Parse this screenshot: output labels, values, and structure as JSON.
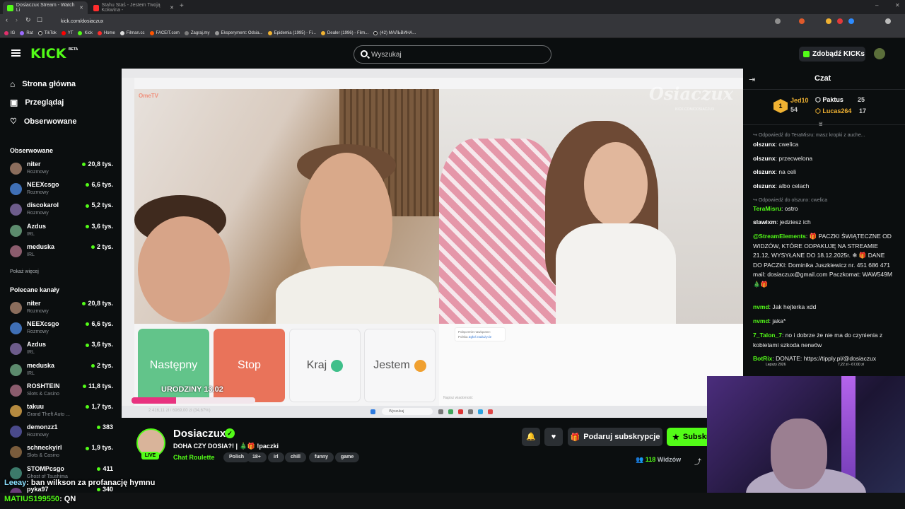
{
  "browser": {
    "tabs": [
      {
        "label": "Dosiaczux Stream - Watch Li",
        "color": "#53fc18"
      },
      {
        "label": "Stahu Staś - Jestem Twoją Kokwina -",
        "color": "#ff2d2d"
      }
    ],
    "url": "kick.com/dosiaczux",
    "bookmarks": [
      "IG",
      "Rat",
      "TikTok",
      "YT",
      "Kick",
      "Home",
      "Filman.cc",
      "FACEIT.com",
      "Zagraj.my",
      "Eksperyment: Odsia...",
      "Epidemia (1995) - Fi...",
      "Dealer (1996) - Film...",
      "(42) МАЛЬВИНА..."
    ]
  },
  "header": {
    "logo": "KICK",
    "beta": "BETA",
    "search_placeholder": "Wyszukaj",
    "get_kicks": "Zdobądź KICKs"
  },
  "sidebar": {
    "nav": [
      {
        "label": "Strona główna",
        "icon": "home-icon"
      },
      {
        "label": "Przeglądaj",
        "icon": "browse-icon"
      },
      {
        "label": "Obserwowane",
        "icon": "heart-icon"
      }
    ],
    "followed_title": "Obserwowane",
    "followed": [
      {
        "name": "niter",
        "category": "Rozmowy",
        "viewers": "20,8 tys."
      },
      {
        "name": "NEEXcsgo",
        "category": "Rozmowy",
        "viewers": "6,6 tys."
      },
      {
        "name": "discokarol",
        "category": "Rozmowy",
        "viewers": "5,2 tys."
      },
      {
        "name": "Azdus",
        "category": "IRL",
        "viewers": "3,6 tys."
      },
      {
        "name": "meduska",
        "category": "IRL",
        "viewers": "2 tys."
      }
    ],
    "show_more": "Pokaż więcej",
    "recommended_title": "Polecane kanały",
    "recommended": [
      {
        "name": "niter",
        "category": "Rozmowy",
        "viewers": "20,8 tys."
      },
      {
        "name": "NEEXcsgo",
        "category": "Rozmowy",
        "viewers": "6,6 tys."
      },
      {
        "name": "Azdus",
        "category": "IRL",
        "viewers": "3,6 tys."
      },
      {
        "name": "meduska",
        "category": "IRL",
        "viewers": "2 tys."
      },
      {
        "name": "ROSHTEIN",
        "category": "Slots & Casino",
        "viewers": "11,8 tys."
      },
      {
        "name": "takuu",
        "category": "Grand Theft Auto ...",
        "viewers": "1,7 tys."
      },
      {
        "name": "demonzz1",
        "category": "Rozmowy",
        "viewers": "383"
      },
      {
        "name": "schneckyirl",
        "category": "Slots & Casino",
        "viewers": "1,9 tys."
      },
      {
        "name": "STOMPcsgo",
        "category": "Ghost of Tsushima",
        "viewers": "411"
      },
      {
        "name": "pyka97",
        "category": "",
        "viewers": "340"
      }
    ]
  },
  "video": {
    "watermark": "Osiaczux",
    "watermark_sub": "KICK.COM/DOSIACZUX",
    "omegle_logo": "OmeTV",
    "buttons": {
      "next": "Następny",
      "stop": "Stop",
      "country": "Kraj",
      "iam": "Jestem"
    },
    "connected_title": "Połączenie nawiązane:",
    "connected_country": "Polska",
    "connected_link": "Zgłoś nadużycie",
    "message_placeholder": "Napisz wiadomość",
    "birthday": "URODZINY 13.02",
    "goal_text": "2 416,11 zł / 6969,00 zł (34,67%)",
    "goal_fraction": 0.3467,
    "taskbar_search": "Wyszukaj"
  },
  "channel": {
    "name": "Dosiaczux",
    "live": "LIVE",
    "title": "DOHA CZY DOSIA?! | 🎄🎁 !paczki",
    "category": "Chat Roulette",
    "tags": [
      "Polish",
      "18+",
      "irl",
      "chill",
      "funny",
      "game"
    ],
    "gift_label": "Podaruj subskrypcje",
    "subscribe_label": "Subskrybuj",
    "viewers": "118",
    "viewers_label": "Widzów"
  },
  "chat": {
    "title": "Czat",
    "leaderboard": [
      {
        "rank": "1",
        "name": "Jed10",
        "count": "54"
      },
      {
        "name": "Paktus",
        "count": "25"
      },
      {
        "name": "Lucas264",
        "count": "17"
      }
    ],
    "messages": [
      {
        "reply": "Odpowiedź do TeraMisru: masz kropki z auche..."
      },
      {
        "user": "olszunx",
        "text": "cwelica",
        "color": "#ffffff"
      },
      {
        "user": "olszunx",
        "text": "przecwelona",
        "color": "#ffffff"
      },
      {
        "user": "olszunx",
        "text": "na celi",
        "color": "#ffffff"
      },
      {
        "user": "olszunx",
        "text": "albo celach",
        "color": "#ffffff"
      },
      {
        "reply": "Odpowiedź do olszunx: cwelica"
      },
      {
        "user": "TeraMisru",
        "text": "ostro",
        "color": "#53fc18"
      },
      {
        "user": "slawixm",
        "text": "jedziesz ich",
        "color": "#ffffff"
      },
      {
        "user": "@StreamElements",
        "text": "🎁 PACZKI ŚWIĄTECZNE OD WIDZÓW, KTÓRE ODPAKUJĘ NA STREAMIE 21.12, WYSYŁANE DO 18.12.2025r. ❄ 🎁 DANE DO PACZKI: Dominika Juszkiewicz nr. 451 686 471 mail: dosiaczux@gmail.com Paczkomat: WAW549M 🎄🎁",
        "color": "#53fc18"
      },
      {
        "user": "nvmd",
        "text": "Jak hejterka xdd",
        "color": "#53fc18"
      },
      {
        "user": "nvmd",
        "text": "jaka*",
        "color": "#53fc18"
      },
      {
        "user": "7_Talon_7",
        "text": "no i dobrze że nie ma do czynienia z kobietami szkoda nerwów",
        "color": "#53fc18"
      },
      {
        "user": "BotRix",
        "text": "DONATE: https://tipply.pl/@dosiaczux",
        "color": "#53fc18"
      }
    ]
  },
  "overlay": {
    "line1_user": "Leeay",
    "line1_text": ": ban wilkson za profanację hymnu",
    "line2_user": "MATIUS199550",
    "line2_text": ": QN",
    "cam_label_left": "Lepszy 2026",
    "cam_label_right": "7,22 zł - 67,00 zł"
  }
}
